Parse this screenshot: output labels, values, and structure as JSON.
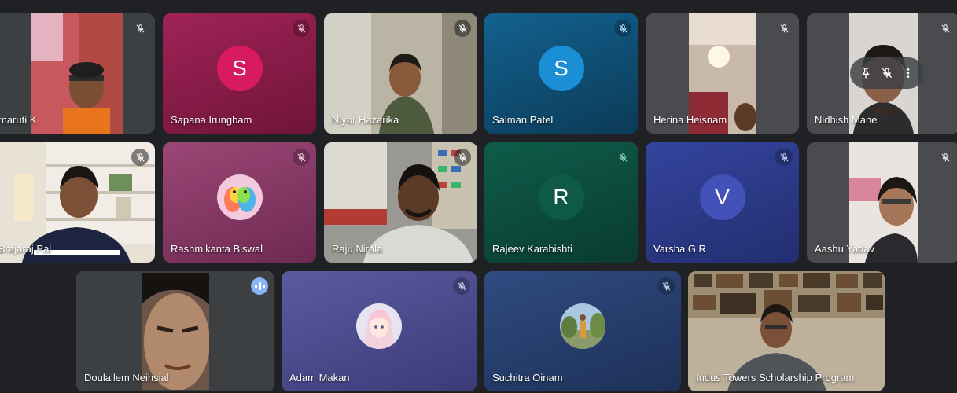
{
  "colors": {
    "stage_background": "#202124",
    "speaking_outline": "#a8c7fa"
  },
  "participants": [
    {
      "name": "maruti K",
      "tile_color": "#3c4043",
      "mute": true,
      "avatar": "video-pink"
    },
    {
      "name": "Sapana Irungbam",
      "tile_color": "#8a1c4a",
      "mute": true,
      "avatar_letter": "S",
      "avatar_color": "#d81b60"
    },
    {
      "name": "Niyor Hazarika",
      "tile_color": "#8f8a79",
      "mute": true,
      "avatar": "video-room"
    },
    {
      "name": "Salman Patel",
      "tile_color": "#0f4f75",
      "mute": true,
      "avatar_letter": "S",
      "avatar_color": "#1a8fd6"
    },
    {
      "name": "Herina Heisnam",
      "tile_color": "#4a4b4e",
      "mute": true,
      "avatar": "video-lamp"
    },
    {
      "name": "Nidhish Mane",
      "tile_color": "#4a4b4e",
      "mute": true,
      "avatar": "video-face"
    },
    {
      "name": "Brajaraj Pal",
      "tile_color": "#3c4043",
      "mute": true,
      "avatar": "video-shelf"
    },
    {
      "name": "Rashmikanta Biswal",
      "tile_color": "#8d3a6a",
      "mute": true,
      "avatar": "picture-birds"
    },
    {
      "name": "Raju Nirala",
      "tile_color": "#6e6c67",
      "mute": true,
      "avatar": "video-office"
    },
    {
      "name": "Rajeev Karabishti",
      "tile_color": "#0c4a3c",
      "mute": true,
      "avatar_letter": "R",
      "avatar_color": "#0e5a47"
    },
    {
      "name": "Varsha G R",
      "tile_color": "#2c3a8a",
      "mute": true,
      "avatar_letter": "V",
      "avatar_color": "#3949ab"
    },
    {
      "name": "Aashu Yadav",
      "tile_color": "#4a4b4e",
      "mute": true,
      "avatar": "video-girl"
    },
    {
      "name": "Doulallem Neihsial",
      "tile_color": "#3c4043",
      "mute": false,
      "speaking": true,
      "avatar": "video-close"
    },
    {
      "name": "Adam Makan",
      "tile_color": "#4a4a8c",
      "mute": true,
      "avatar": "picture-anime"
    },
    {
      "name": "Suchitra Oinam",
      "tile_color": "#273f6c",
      "mute": true,
      "avatar": "picture-landscape"
    },
    {
      "name": "Indus Towers Scholarship Program",
      "tile_color": "#8c8570",
      "mute": false,
      "avatar": "video-frames"
    }
  ],
  "icons": {
    "mic_off": "mic-off-icon",
    "speaking": "audio-level-icon",
    "pin": "pin-icon",
    "more": "more-vert-icon"
  }
}
